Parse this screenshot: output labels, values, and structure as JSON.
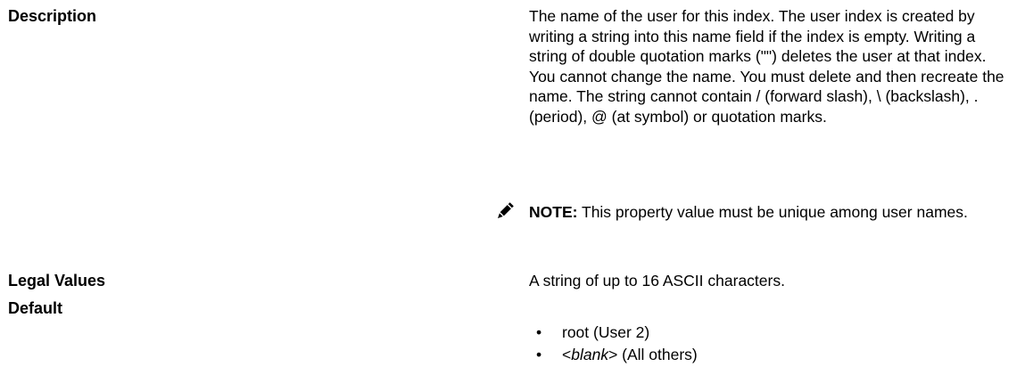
{
  "description": {
    "label": "Description",
    "text": "The name of the user for this index. The user index is created by writing a string into this name field if the index is empty. Writing a string of double quotation marks (\"\") deletes the user at that index. You cannot change the name. You must delete and then recreate the name. The string cannot contain / (forward slash), \\ (backslash), . (period), @ (at symbol) or quotation marks.",
    "note": {
      "icon": "pencil-note-icon",
      "label": "NOTE:",
      "text": " This property value must be unique among user names."
    }
  },
  "legal_values": {
    "label": "Legal Values",
    "text": "A string of up to 16 ASCII characters."
  },
  "default": {
    "label": "Default",
    "items": [
      {
        "bullet": "•",
        "text": "root (User 2)"
      },
      {
        "bullet": "•",
        "prefix": "<",
        "emphasis": "blank",
        "suffix": "> (All others)"
      }
    ]
  }
}
